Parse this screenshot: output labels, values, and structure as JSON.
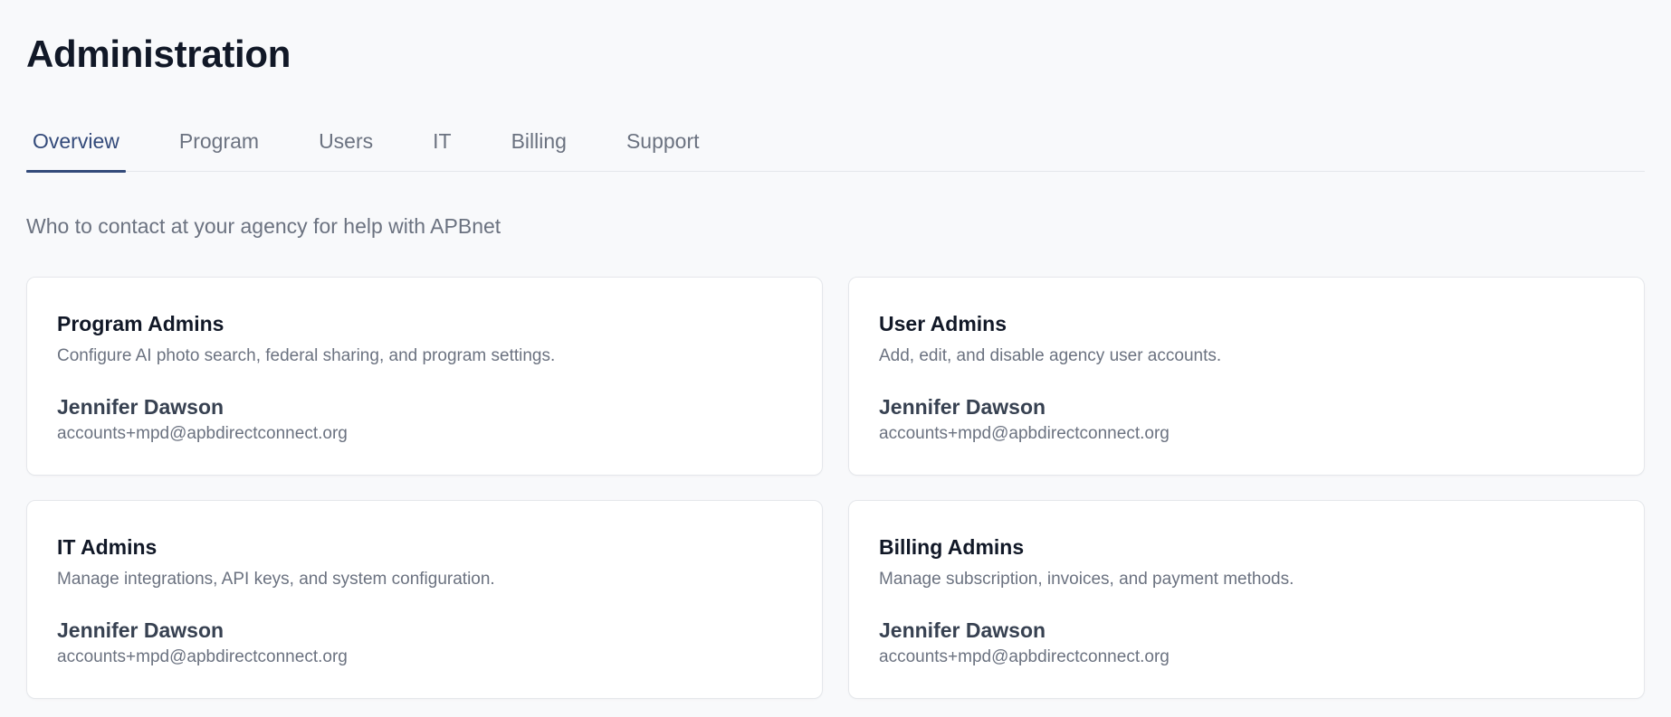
{
  "page": {
    "title": "Administration",
    "intro": "Who to contact at your agency for help with APBnet"
  },
  "tabs": [
    {
      "label": "Overview",
      "active": true
    },
    {
      "label": "Program",
      "active": false
    },
    {
      "label": "Users",
      "active": false
    },
    {
      "label": "IT",
      "active": false
    },
    {
      "label": "Billing",
      "active": false
    },
    {
      "label": "Support",
      "active": false
    }
  ],
  "cards": [
    {
      "title": "Program Admins",
      "description": "Configure AI photo search, federal sharing, and program settings.",
      "contact_name": "Jennifer Dawson",
      "contact_email": "accounts+mpd@apbdirectconnect.org"
    },
    {
      "title": "User Admins",
      "description": "Add, edit, and disable agency user accounts.",
      "contact_name": "Jennifer Dawson",
      "contact_email": "accounts+mpd@apbdirectconnect.org"
    },
    {
      "title": "IT Admins",
      "description": "Manage integrations, API keys, and system configuration.",
      "contact_name": "Jennifer Dawson",
      "contact_email": "accounts+mpd@apbdirectconnect.org"
    },
    {
      "title": "Billing Admins",
      "description": "Manage subscription, invoices, and payment methods.",
      "contact_name": "Jennifer Dawson",
      "contact_email": "accounts+mpd@apbdirectconnect.org"
    }
  ],
  "colors": {
    "background": "#f8f9fb",
    "accent": "#334a7a",
    "muted_text": "#6b7280",
    "card_border": "#e5e7eb"
  }
}
